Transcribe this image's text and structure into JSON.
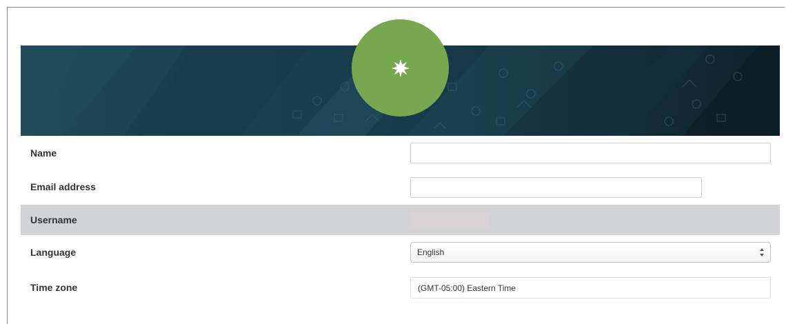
{
  "profile": {
    "avatar_icon": "starburst-icon",
    "avatar_color": "#77a84f",
    "banner_color": "#173849"
  },
  "form": {
    "name": {
      "label": "Name",
      "value": ""
    },
    "email": {
      "label": "Email address",
      "value": ""
    },
    "username": {
      "label": "Username",
      "value": ""
    },
    "language": {
      "label": "Language",
      "selected": "English"
    },
    "timezone": {
      "label": "Time zone",
      "value": "(GMT-05:00) Eastern Time"
    }
  }
}
